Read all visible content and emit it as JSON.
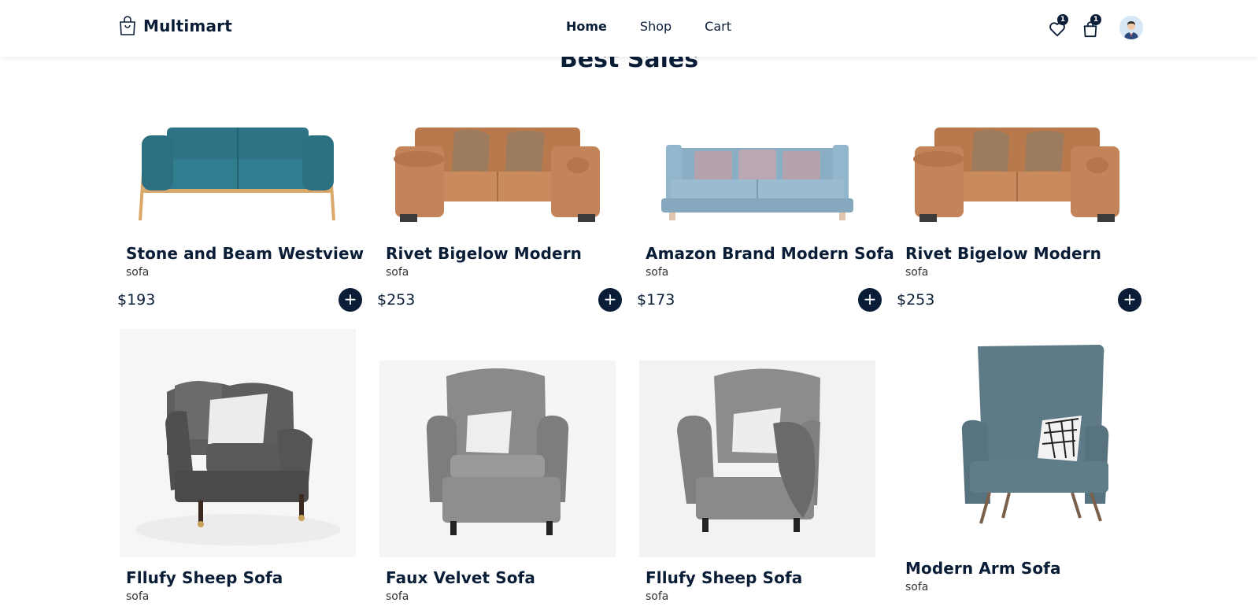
{
  "app": {
    "brand": "Multimart"
  },
  "nav": {
    "items": [
      {
        "label": "Home",
        "active": true
      },
      {
        "label": "Shop",
        "active": false
      },
      {
        "label": "Cart",
        "active": false
      }
    ]
  },
  "header": {
    "wishlist_count": "1",
    "cart_count": "1"
  },
  "section": {
    "title": "Best Sales"
  },
  "products": [
    {
      "name": "Stone and Beam Westview",
      "category": "sofa",
      "price": "$193",
      "add": "+"
    },
    {
      "name": "Rivet Bigelow Modern",
      "category": "sofa",
      "price": "$253",
      "add": "+"
    },
    {
      "name": "Amazon Brand Modern Sofa",
      "category": "sofa",
      "price": "$173",
      "add": "+"
    },
    {
      "name": "Rivet Bigelow Modern",
      "category": "sofa",
      "price": "$253",
      "add": "+"
    },
    {
      "name": "Fllufy Sheep Sofa",
      "category": "sofa"
    },
    {
      "name": "Faux Velvet Sofa",
      "category": "sofa"
    },
    {
      "name": "Fllufy Sheep Sofa",
      "category": "sofa"
    },
    {
      "name": "Modern Arm Sofa",
      "category": "sofa"
    }
  ],
  "colors": {
    "primary": "#0a1d37",
    "teal_sofa": "#2f7b8f",
    "tan_sofa": "#c98a5e",
    "blue_sofa": "#8fb0c6",
    "grey_chair": "#6b6b6b",
    "slate_chair": "#5d7a86"
  }
}
